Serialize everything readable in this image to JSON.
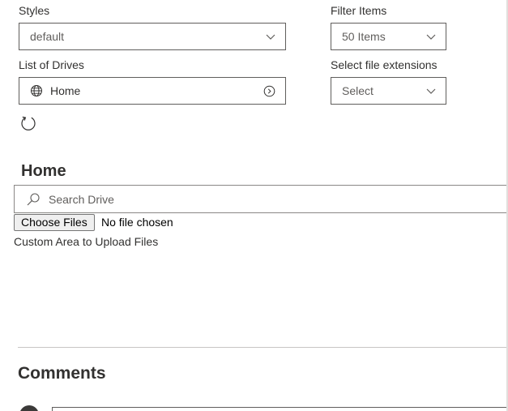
{
  "filters": {
    "styles_label": "Styles",
    "styles_value": "default",
    "filter_items_label": "Filter Items",
    "filter_items_value": "50 Items",
    "drives_label": "List of Drives",
    "drives_value": "Home",
    "extensions_label": "Select file extensions",
    "extensions_value": "Select"
  },
  "drive": {
    "heading": "Home",
    "search_placeholder": "Search Drive"
  },
  "upload": {
    "choose_button": "Choose Files",
    "file_status": "No file chosen",
    "area_label": "Custom Area to Upload Files"
  },
  "comments": {
    "heading": "Comments"
  },
  "icons": {
    "dropdown": "chevron-down-icon",
    "drive": "globe-icon",
    "drive_action": "chevron-right-circle-icon",
    "refresh": "refresh-icon",
    "search": "search-icon"
  }
}
